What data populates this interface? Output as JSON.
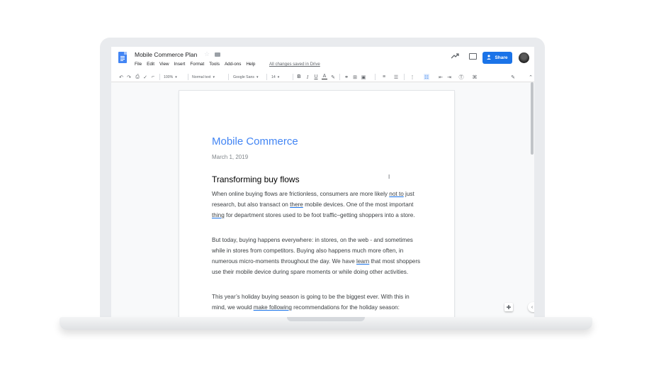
{
  "header": {
    "title": "Mobile Commerce Plan",
    "menu": [
      "File",
      "Edit",
      "View",
      "Insert",
      "Format",
      "Tools",
      "Add-ons",
      "Help"
    ],
    "saved_status": "All changes saved in Drive",
    "share_label": "Share"
  },
  "toolbar": {
    "zoom": "100%",
    "style": "Normal text",
    "font": "Google Sans",
    "font_size": "14"
  },
  "document": {
    "title": "Mobile Commerce",
    "date": "March 1, 2019",
    "heading": "Transforming buy flows",
    "para1": {
      "a": "When online buying flows are frictionless, consumers are more likely ",
      "u1": "not to",
      "b": " just research, but also transact on ",
      "u2": "there",
      "c": " mobile devices. One of the most important ",
      "u3": "thing",
      "d": " for department stores used to be foot traffic–getting shoppers into a store."
    },
    "para2": {
      "a": "But today, buying happens everywhere: in stores, on the web - and sometimes while in stores from competitors. Buying also happens much more often, in numerous micro-moments throughout the day. We have ",
      "u1": "learn",
      "b": " that most shoppers use their mobile device during spare moments or while doing other activities."
    },
    "para3": {
      "a": "This year’s holiday buying season is going to be the biggest ever. With this in mind, we would ",
      "u1": "make following",
      "b": " recommendations for the holiday season:"
    }
  },
  "colors": {
    "accent": "#1a73e8",
    "doc_title": "#4285f4"
  },
  "icons": [
    "docs-logo-icon",
    "star-icon",
    "folder-icon",
    "trending-icon",
    "comment-icon",
    "person-add-icon",
    "avatar"
  ]
}
